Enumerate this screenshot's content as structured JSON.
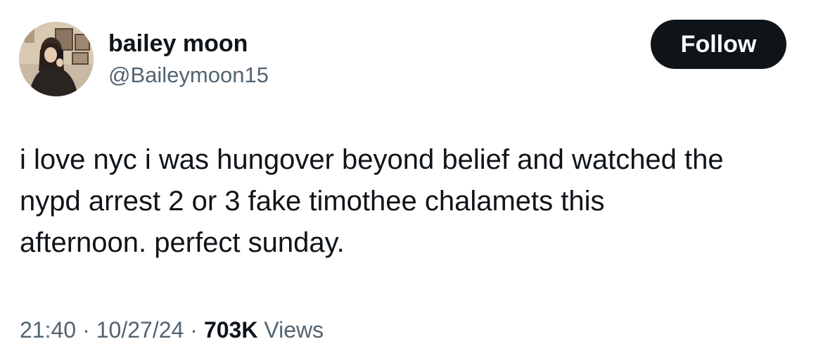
{
  "author": {
    "display_name": "bailey moon",
    "handle": "@Baileymoon15",
    "avatar_icon": "profile-photo-avatar"
  },
  "follow_button": {
    "label": "Follow",
    "bg_color": "#0f1419",
    "text_color": "#ffffff"
  },
  "tweet": {
    "lines": [
      "i love nyc i was hungover beyond belief and watched the",
      "nypd arrest 2 or 3 fake timothee chalamets this",
      "afternoon. perfect sunday."
    ]
  },
  "meta": {
    "time": "21:40",
    "separator": "·",
    "date": "10/27/24",
    "views_count": "703K",
    "views_label": "Views",
    "secondary_text_color": "#536471"
  }
}
